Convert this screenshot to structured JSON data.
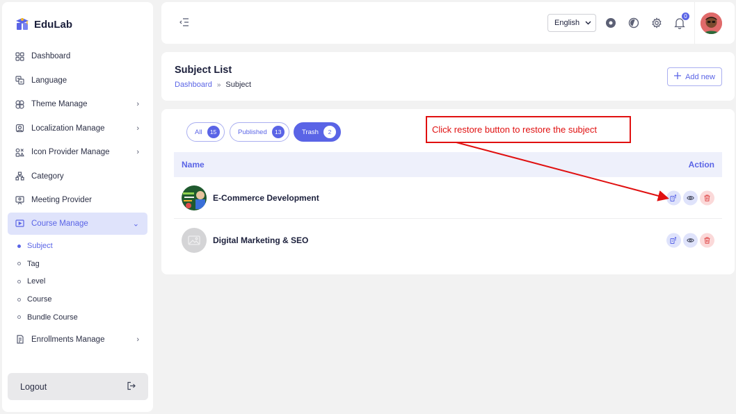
{
  "app": {
    "name": "EduLab"
  },
  "sidebar": {
    "items": [
      {
        "label": "Dashboard",
        "icon": "dashboard-icon"
      },
      {
        "label": "Language",
        "icon": "language-icon"
      },
      {
        "label": "Theme Manage",
        "icon": "theme-icon",
        "chevron": true
      },
      {
        "label": "Localization Manage",
        "icon": "localization-icon",
        "chevron": true
      },
      {
        "label": "Icon Provider Manage",
        "icon": "icon-provider-icon",
        "chevron": true
      },
      {
        "label": "Category",
        "icon": "category-icon"
      },
      {
        "label": "Meeting Provider",
        "icon": "meeting-icon"
      },
      {
        "label": "Course Manage",
        "icon": "course-icon",
        "chevron": true,
        "active": true
      }
    ],
    "subitems": [
      {
        "label": "Subject",
        "active": true
      },
      {
        "label": "Tag"
      },
      {
        "label": "Level"
      },
      {
        "label": "Course"
      },
      {
        "label": "Bundle Course"
      }
    ],
    "after_items": [
      {
        "label": "Enrollments Manage",
        "icon": "enrollments-icon",
        "chevron": true
      }
    ],
    "logout_label": "Logout"
  },
  "topbar": {
    "language": "English",
    "notification_count": "0"
  },
  "header": {
    "title": "Subject List",
    "breadcrumb": {
      "home": "Dashboard",
      "separator": "»",
      "current": "Subject"
    },
    "add_button": "Add new"
  },
  "tabs": [
    {
      "label": "All",
      "count": "15"
    },
    {
      "label": "Published",
      "count": "13"
    },
    {
      "label": "Trash",
      "count": "2",
      "active": true
    }
  ],
  "table": {
    "headers": {
      "name": "Name",
      "action": "Action"
    },
    "rows": [
      {
        "name": "E-Commerce Development",
        "thumb": "course-image"
      },
      {
        "name": "Digital Marketing & SEO",
        "thumb": "placeholder-image"
      }
    ]
  },
  "annotation": {
    "text": "Click restore button to restore the subject",
    "color": "#e01010"
  },
  "colors": {
    "accent": "#5a64e6",
    "danger": "#e04b4b"
  }
}
